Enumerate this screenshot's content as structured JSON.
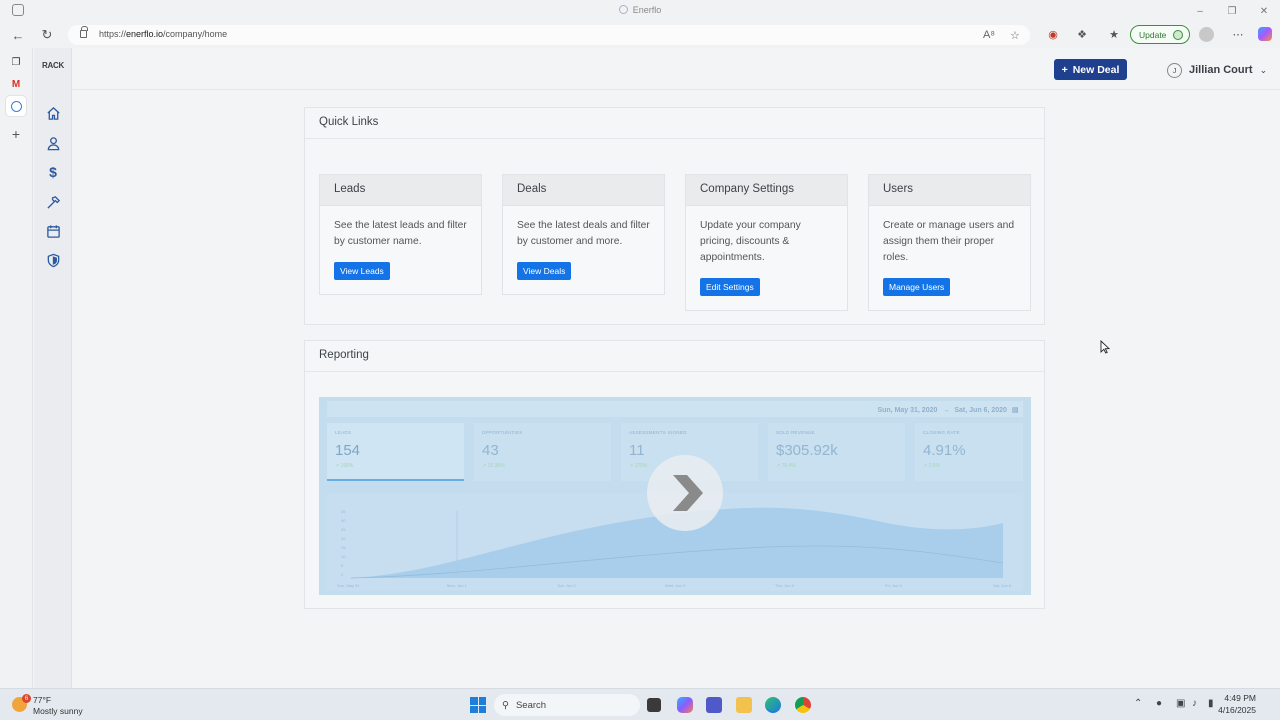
{
  "browser": {
    "window_title": "Enerflo",
    "url_prefix": "https://",
    "url_domain": "enerflo.io",
    "url_path": "/company/home",
    "update_label": "Update"
  },
  "app": {
    "brand": "RACK",
    "header": {
      "new_deal_label": "New Deal",
      "user_initial": "J",
      "user_name": "Jillian Court"
    },
    "sidebar_icons": [
      "home-icon",
      "user-icon",
      "dollar-icon",
      "hammer-icon",
      "calendar-icon",
      "shield-icon"
    ]
  },
  "quick_links": {
    "title": "Quick Links",
    "cards": [
      {
        "title": "Leads",
        "description": "See the latest leads and filter by customer name.",
        "button": "View Leads"
      },
      {
        "title": "Deals",
        "description": "See the latest deals and filter by customer and more.",
        "button": "View Deals"
      },
      {
        "title": "Company Settings",
        "description": "Update your company pricing, discounts & appointments.",
        "button": "Edit Settings"
      },
      {
        "title": "Users",
        "description": "Create or manage users and assign them their proper roles.",
        "button": "Manage Users"
      }
    ]
  },
  "reporting": {
    "title": "Reporting",
    "video": {
      "date_start": "Sun, May 31, 2020",
      "date_sep": "→",
      "date_end": "Sat, Jun 6, 2020",
      "stats": [
        {
          "label": "LEADS",
          "value": "154",
          "change": "↗ 195%"
        },
        {
          "label": "OPPORTUNITIES",
          "value": "43",
          "change": "↗ 15.38%"
        },
        {
          "label": "ASSESSMENTS SIGNED",
          "value": "11",
          "change": "↗ 175%"
        },
        {
          "label": "SOLD REVENUE",
          "value": "$305.92k",
          "change": "↗ 78.4%"
        },
        {
          "label": "CLOSING RATE",
          "value": "4.91%",
          "change": "↗ 3.6%"
        }
      ],
      "chart_x_labels": [
        "Sun, May 31",
        "Mon, Jun 1",
        "Tue, Jun 2",
        "Wed, Jun 3",
        "Thu, Jun 4",
        "Fri, Jun 5",
        "Sat, Jun 6"
      ],
      "chart_y_labels": [
        "35",
        "30",
        "25",
        "20",
        "15",
        "10",
        "5",
        "0"
      ]
    }
  },
  "taskbar": {
    "temperature": "77°F",
    "weather": "Mostly sunny",
    "weather_badge": "6",
    "search_label": "Search",
    "time": "4:49 PM",
    "date": "4/16/2025"
  }
}
